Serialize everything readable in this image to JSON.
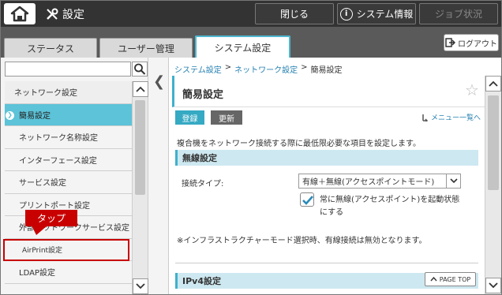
{
  "header": {
    "title": "設定",
    "close_label": "閉じる",
    "system_info_label": "システム情報",
    "job_status_label": "ジョブ状況"
  },
  "tabs": [
    {
      "label": "ステータス",
      "active": false
    },
    {
      "label": "ユーザー管理",
      "active": false
    },
    {
      "label": "システム設定",
      "active": true
    }
  ],
  "logout_label": "ログアウト",
  "sidebar": {
    "search_value": "",
    "items": [
      {
        "label": "ネットワーク設定",
        "type": "header"
      },
      {
        "label": "簡易設定",
        "type": "selected"
      },
      {
        "label": "ネットワーク名称設定",
        "type": "item"
      },
      {
        "label": "インターフェース設定",
        "type": "item"
      },
      {
        "label": "サービス設定",
        "type": "item"
      },
      {
        "label": "プリントポート設定",
        "type": "item"
      },
      {
        "label": "外部ネットワークサービス設定",
        "type": "item"
      },
      {
        "label": "AirPrint設定",
        "type": "sub"
      },
      {
        "label": "LDAP設定",
        "type": "item"
      }
    ]
  },
  "annotation": {
    "callout_label": "タップ"
  },
  "breadcrumb": {
    "crumb1": "システム設定",
    "crumb2": "ネットワーク設定",
    "current": "簡易設定",
    "separator": ">"
  },
  "page": {
    "title": "簡易設定",
    "register_label": "登録",
    "update_label": "更新",
    "menu_link_label": "メニュー一覧へ",
    "intro_text": "複合機をネットワーク接続する際に最低限必要な項目を設定します。",
    "wireless_section": "無線設定",
    "connection_type_label": "接続タイプ:",
    "connection_type_value": "有線＋無線(アクセスポイントモード)",
    "always_wireless_label": "常に無線(アクセスポイント)を起動状態にする",
    "always_wireless_checked": true,
    "note_text": "※インフラストラクチャーモード選択時、有線接続は無効となります。",
    "ipv4_section": "IPv4設定",
    "page_top_label": "PAGE TOP"
  },
  "colors": {
    "accent": "#3fb0cc",
    "selected_item": "#5cc3d8",
    "callout": "#c80000",
    "topbar": "#333333"
  }
}
